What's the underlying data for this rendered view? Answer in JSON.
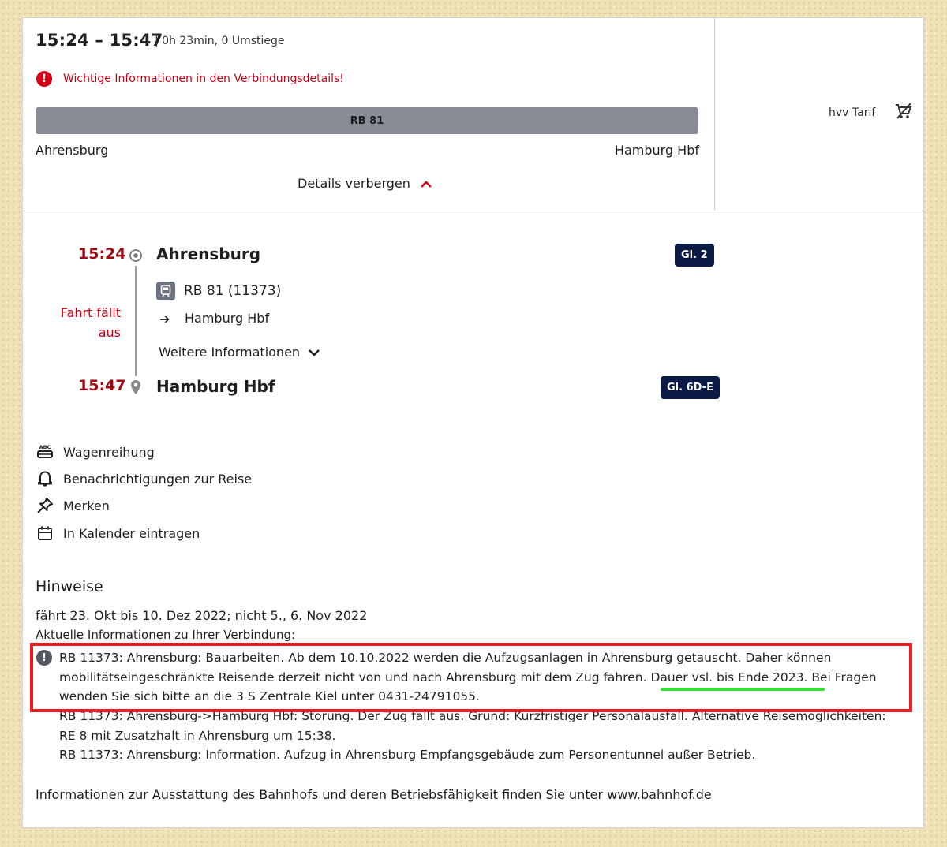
{
  "header": {
    "time_range": "15:24 – 15:47",
    "duration": "| 0h 23min, 0 Umstiege",
    "warning": "Wichtige Informationen in den Verbindungsdetails!",
    "train_bar": "RB 81",
    "from": "Ahrensburg",
    "to": "Hamburg Hbf",
    "details_toggle": "Details verbergen",
    "tarif": "hvv Tarif"
  },
  "journey": {
    "departure": {
      "time": "15:24",
      "station": "Ahrensburg",
      "track": "Gl. 2"
    },
    "arrival": {
      "time": "15:47",
      "station": "Hamburg Hbf",
      "track": "Gl. 6D-E"
    },
    "cancel_note": "Fahrt fällt aus",
    "train": "RB 81 (11373)",
    "direction_arrow": "➔",
    "direction": "Hamburg Hbf",
    "more_info": "Weitere Informationen"
  },
  "actions": [
    {
      "label": "Wagenreihung",
      "icon": "coach-sequence-icon"
    },
    {
      "label": "Benachrichtigungen zur Reise",
      "icon": "bell-icon"
    },
    {
      "label": "Merken",
      "icon": "pin-icon"
    },
    {
      "label": "In Kalender eintragen",
      "icon": "calendar-icon"
    }
  ],
  "hinweise": {
    "title": "Hinweise",
    "validity": "fährt 23. Okt bis 10. Dez 2022; nicht 5., 6. Nov 2022",
    "current_info": "Aktuelle Informationen zu Ihrer Verbindung:",
    "notes": [
      "RB 11373: Ahrensburg: Bauarbeiten. Ab dem 10.10.2022 werden die Aufzugsanlagen in Ahrensburg getauscht. Daher können mobilitätseingeschränkte Reisende derzeit nicht von und nach Ahrensburg mit dem Zug fahren. Dauer vsl. bis Ende 2023. Bei Fragen wenden Sie sich bitte an die 3 S Zentrale Kiel unter 0431-24791055.",
      "RB 11373: Ahrensburg->Hamburg Hbf: Störung. Der Zug fällt aus. Grund: Kurzfristiger Personalausfall. Alternative Reisemöglichkeiten: RE 8 mit Zusatzhalt in Ahrensburg um 15:38.",
      "RB 11373: Ahrensburg: Information. Aufzug in Ahrensburg Empfangsgebäude zum Personentunnel außer Betrieb."
    ],
    "footer_text": "Informationen zur Ausstattung des Bahnhofs und deren Betriebsfähigkeit finden Sie unter ",
    "footer_link": "www.bahnhof.de"
  },
  "colors": {
    "accent_red": "#c50014",
    "time_red": "#9e0a12",
    "track_badge": "#0c1a46",
    "highlight_box": "#ee1b22",
    "underline_green": "#33e033"
  }
}
